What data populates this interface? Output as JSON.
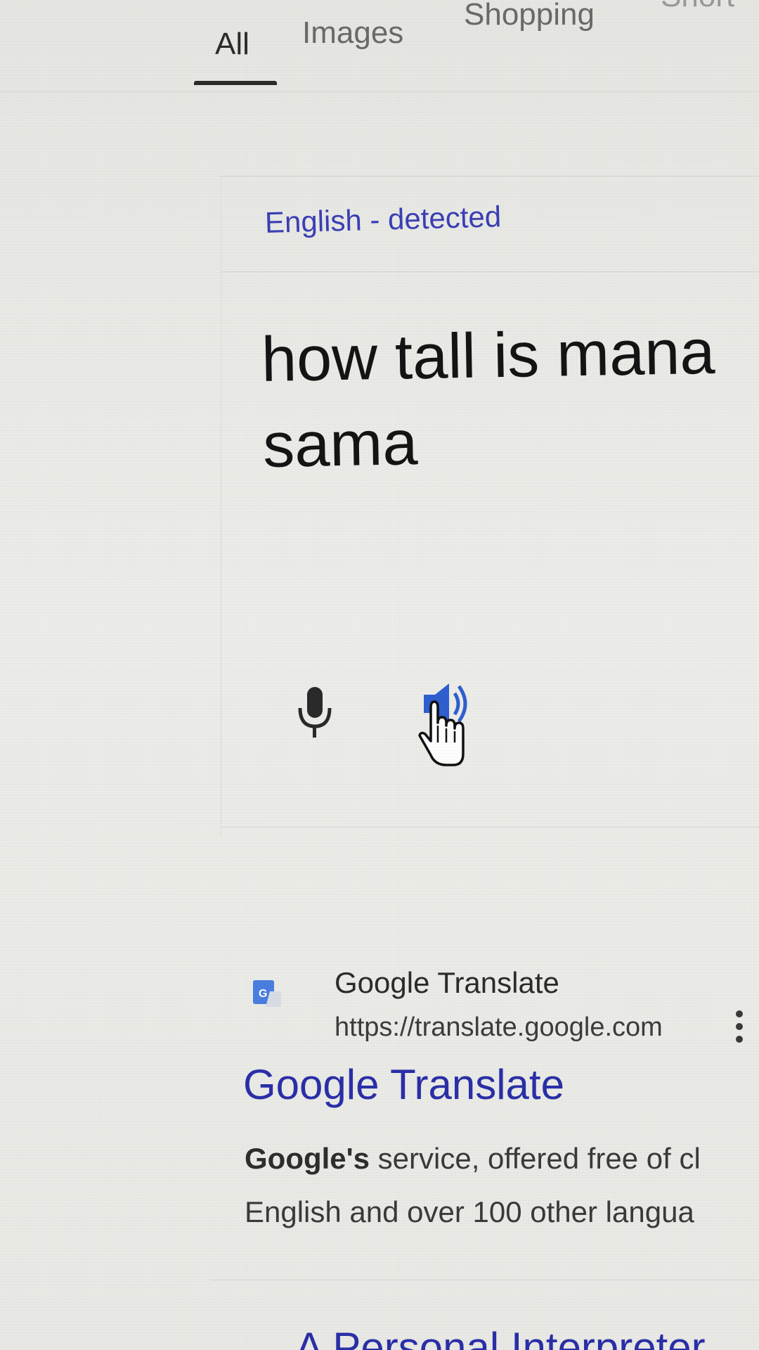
{
  "tabs": [
    {
      "label": "All",
      "active": true
    },
    {
      "label": "Images",
      "active": false
    },
    {
      "label": "Shopping",
      "active": false
    },
    {
      "label": "Short",
      "active": false
    }
  ],
  "translate": {
    "detected_language": "English - detected",
    "source_lines": [
      "how tall is mana",
      "sama"
    ],
    "mic_icon": "microphone-icon",
    "speaker_icon": "speaker-icon"
  },
  "result": {
    "site_name": "Google Translate",
    "url": "https://translate.google.com",
    "title": "Google Translate",
    "snippet_lines": [
      {
        "bold": "Google's",
        "text": " service, offered free of cl"
      },
      {
        "bold": "",
        "text": "English and over 100 other langua"
      }
    ],
    "favicon": "google-translate-icon",
    "menu_icon": "more-vert-icon"
  },
  "next_result": {
    "title": "A Personal Interpreter"
  },
  "colors": {
    "link": "#2a2fa8",
    "accent_blue": "#3a6fd8",
    "text": "#141414"
  }
}
